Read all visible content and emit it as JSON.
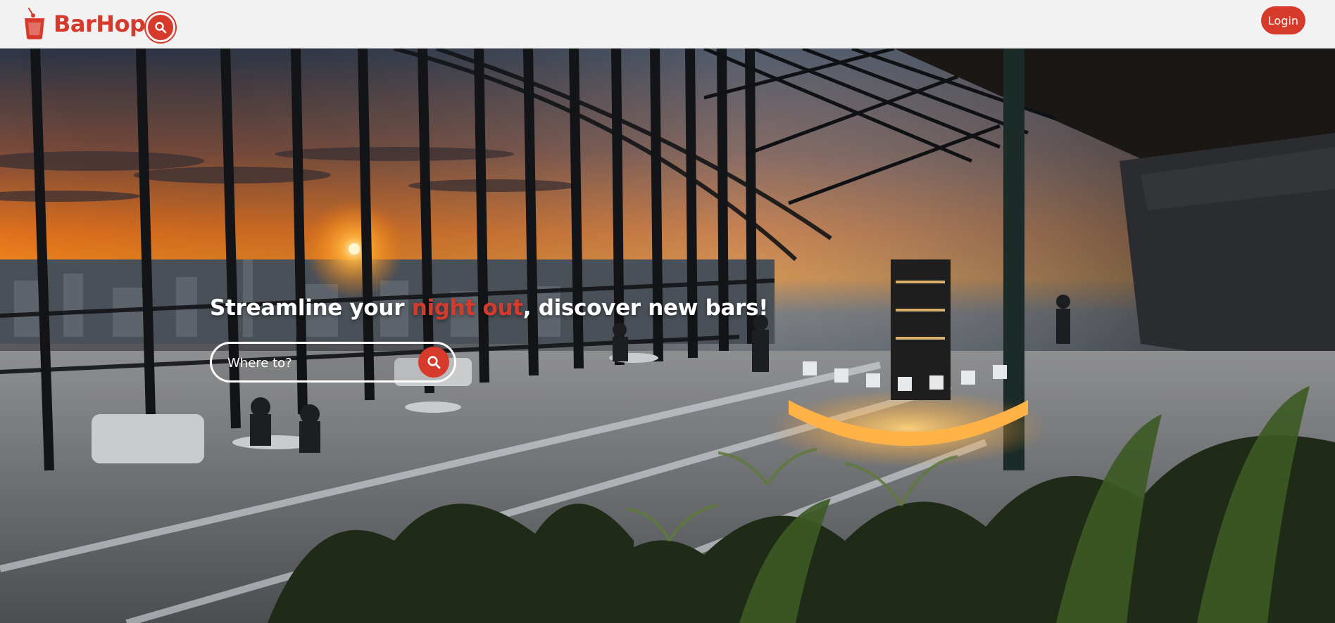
{
  "header": {
    "brand_name": "BarHop",
    "logo_icon": "cocktail-glass-icon",
    "search_icon": "search-icon",
    "login_label": "Login"
  },
  "hero": {
    "image_subject": "rooftop-bar-sunset-photo",
    "headline_before": "Streamline your ",
    "headline_accent": "night out",
    "headline_after": ", discover new bars!",
    "search_placeholder": "Where to?",
    "search_icon": "search-icon"
  },
  "colors": {
    "brand_red": "#d63a2b",
    "header_bg": "#f2f2f2",
    "text_on_image": "#ffffff"
  }
}
